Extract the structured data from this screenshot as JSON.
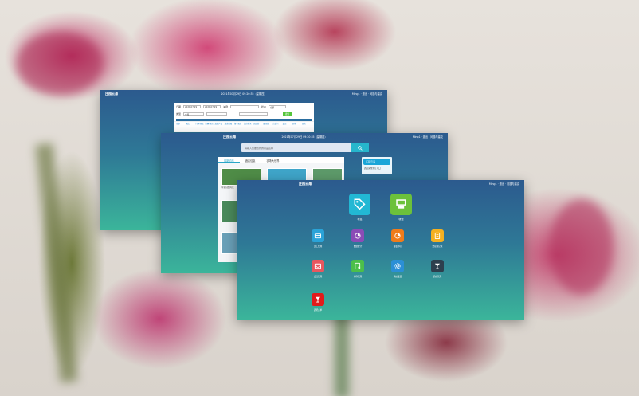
{
  "background": {
    "description_color": "#d9d3cc"
  },
  "window1": {
    "title": "庄园云海",
    "time": "2021年07月29日 09:20:35（星期四）",
    "user": "Ming1 · 退出 · 问题与建议",
    "filters": {
      "date_label": "日期",
      "date_from": "2021-07-29",
      "date_to": "2021-07-29",
      "keyword_label": "关键",
      "status_label": "状态",
      "status_value": "全部",
      "type_label": "类型",
      "type_value": "全部",
      "query_button": "搜索"
    },
    "tabs": [
      "全部",
      "酒店",
      "门票/景点",
      "门票/景区",
      "度假产品",
      "旅游线路",
      "租车服务",
      "温泉泡汤",
      "周边游",
      "跟团游",
      "自由行",
      "会议",
      "其他",
      "退款"
    ]
  },
  "window2": {
    "title": "庄园云海",
    "time": "2021年07月29日 09:20:35（星期四）",
    "user": "Ming1 · 退出 · 问题与建议",
    "search_placeholder": "请输入您要查找的商品名称",
    "tabs": [
      "最新动态",
      "酒店信息",
      "农场大世界"
    ],
    "thumb_caption": "享受自然风光",
    "promo_caption": "酒店床位预订入口",
    "promo_badge": "庄园云海"
  },
  "window3": {
    "title": "庄园云海",
    "time": "2021年07月29日 09:20:35（星期四）",
    "user": "Ming1 · 退出 · 问题与建议",
    "primary_apps": [
      {
        "label": "标签",
        "icon": "tag-icon",
        "color": "#22b8d4"
      },
      {
        "label": "收银",
        "icon": "cashier-icon",
        "color": "#6cc13b"
      }
    ],
    "apps": [
      {
        "label": "员工管理",
        "icon": "card-icon",
        "color": "#2aa3d8"
      },
      {
        "label": "数据统计",
        "icon": "pie-chart-icon",
        "color": "#8b4cb6"
      },
      {
        "label": "报表中心",
        "icon": "bar-chart-icon",
        "color": "#f07c1a"
      },
      {
        "label": "交接班记录",
        "icon": "document-icon",
        "color": "#f5b020"
      },
      {
        "label": "会员管理",
        "icon": "inbox-icon",
        "color": "#e8575f"
      },
      {
        "label": "库存管理",
        "icon": "list-check-icon",
        "color": "#4cbf4a"
      },
      {
        "label": "系统设置",
        "icon": "gear-icon",
        "color": "#2b8fd6"
      },
      {
        "label": "酒水管理",
        "icon": "cocktail-icon",
        "color": "#2d3f4e"
      },
      {
        "label": "酒吧点单",
        "icon": "cocktail-icon",
        "color": "#e11b1b"
      }
    ]
  }
}
